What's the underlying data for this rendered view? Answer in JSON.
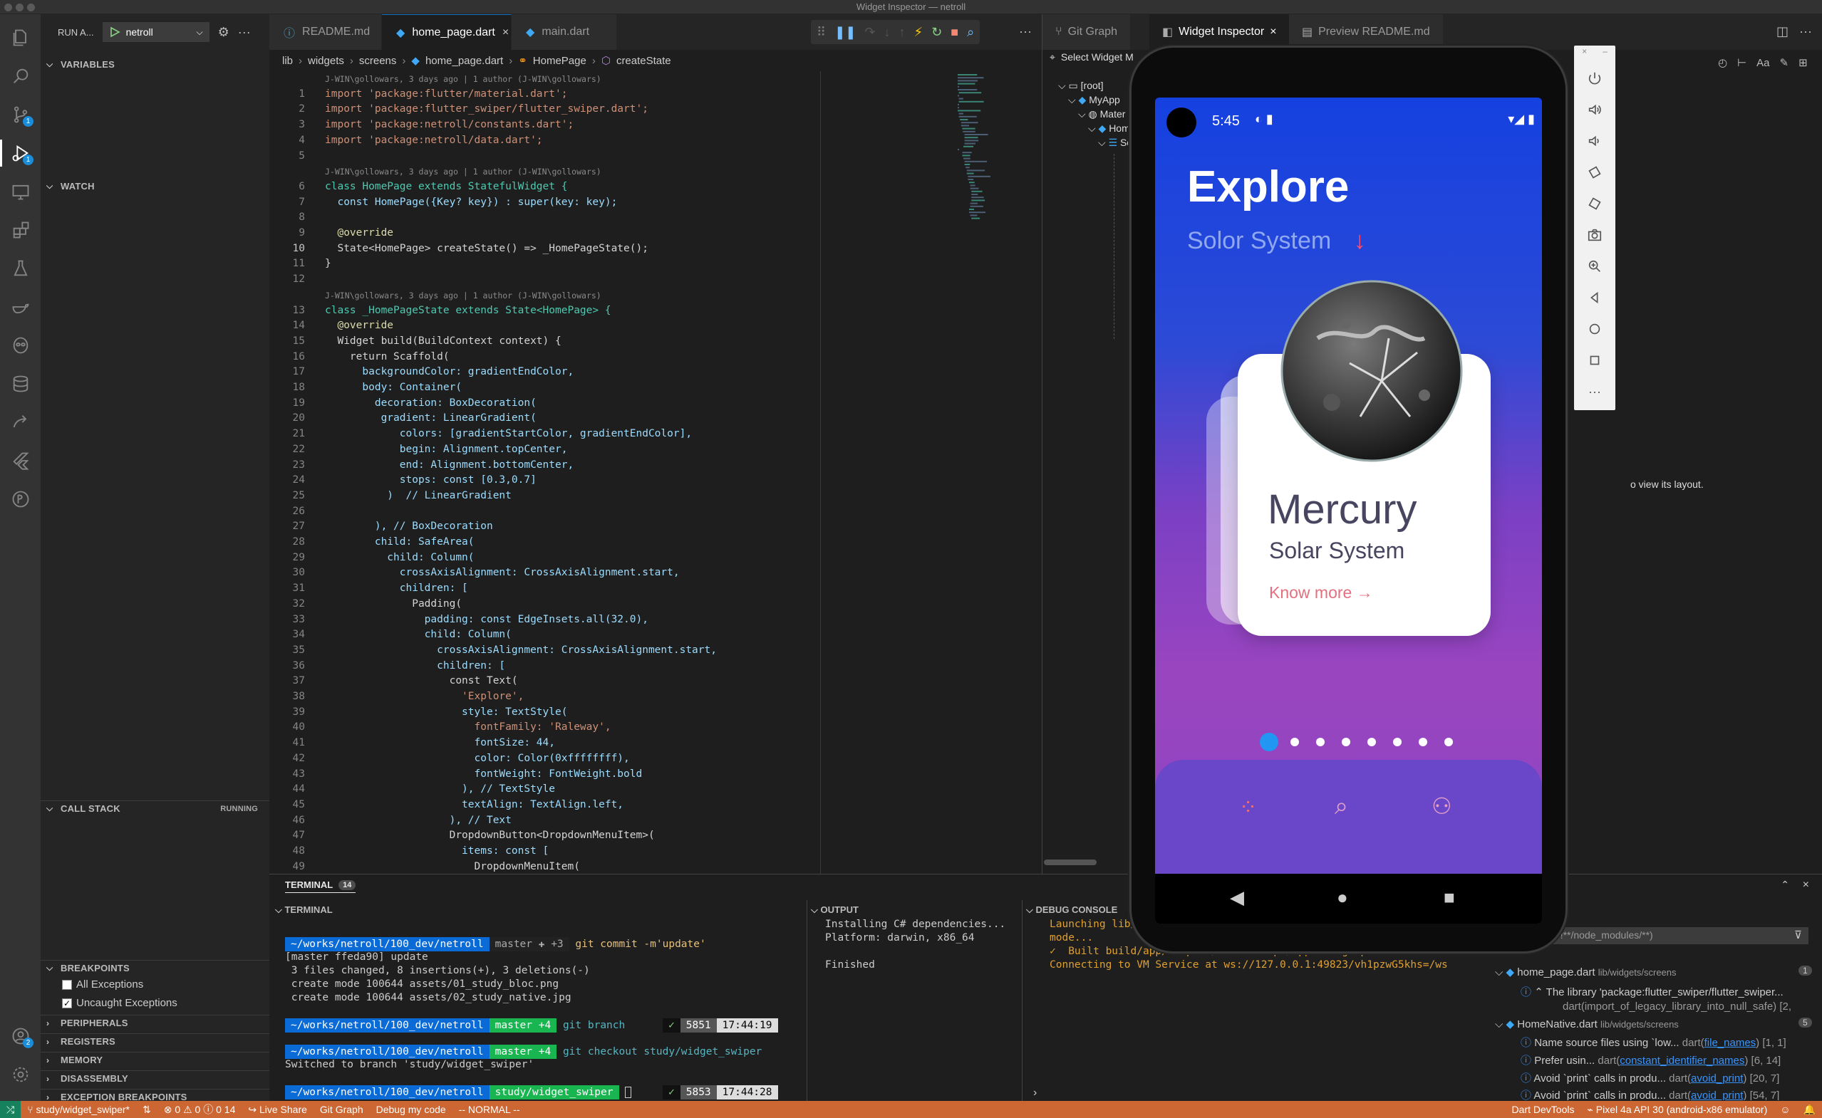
{
  "window_title": "Widget Inspector — netroll",
  "activity_bar": [
    {
      "icon": "files-icon"
    },
    {
      "icon": "search-icon"
    },
    {
      "icon": "source-control-icon",
      "badge": "1"
    },
    {
      "icon": "run-debug-icon",
      "badge": "1"
    },
    {
      "icon": "remote-explorer-icon"
    },
    {
      "icon": "extensions-icon"
    },
    {
      "icon": "testing-icon"
    },
    {
      "icon": "docker-icon"
    },
    {
      "icon": "alien-icon"
    },
    {
      "icon": "database-icon"
    },
    {
      "icon": "live-share-icon"
    },
    {
      "icon": "flutter-icon"
    },
    {
      "icon": "timeline-icon"
    }
  ],
  "accounts_badge": "2",
  "sidebar": {
    "run_label": "RUN A...",
    "config": "netroll",
    "variables": "VARIABLES",
    "watch": "WATCH",
    "call_stack": "CALL STACK",
    "call_stack_state": "RUNNING",
    "breakpoints": "BREAKPOINTS",
    "bp_all": "All Exceptions",
    "bp_uncaught": "Uncaught Exceptions",
    "peripherals": "PERIPHERALS",
    "registers": "REGISTERS",
    "memory": "MEMORY",
    "disassembly": "DISASSEMBLY",
    "exception_breakpoints": "EXCEPTION BREAKPOINTS"
  },
  "editor": {
    "tabs": [
      "README.md",
      "home_page.dart",
      "main.dart"
    ],
    "breadcrumb": [
      "lib",
      "widgets",
      "screens",
      "home_page.dart",
      "HomePage",
      "createState"
    ],
    "blame": [
      "J-WIN\\gollowars, 3 days ago | 1 author (J-WIN\\gollowars)",
      "J-WIN\\gollowars, 3 days ago | 1 author (J-WIN\\gollowars)",
      "J-WIN\\gollowars, 3 days ago | 1 author (J-WIN\\gollowars)"
    ],
    "lines": [
      "import 'package:flutter/material.dart';",
      "import 'package:flutter_swiper/flutter_swiper.dart';",
      "import 'package:netroll/constants.dart';",
      "import 'package:netroll/data.dart';",
      "",
      "class HomePage extends StatefulWidget {",
      "  const HomePage({Key? key}) : super(key: key);",
      "",
      "  @override",
      "  State<HomePage> createState() => _HomePageState();",
      "}",
      "",
      "class _HomePageState extends State<HomePage> {",
      "  @override",
      "  Widget build(BuildContext context) {",
      "    return Scaffold(",
      "      backgroundColor: gradientEndColor,",
      "      body: Container(",
      "        decoration: BoxDecoration(",
      "         gradient: LinearGradient(",
      "            colors: [gradientStartColor, gradientEndColor],",
      "            begin: Alignment.topCenter,",
      "            end: Alignment.bottomCenter,",
      "            stops: const [0.3,0.7]",
      "          )  // LinearGradient",
      "",
      "        ), // BoxDecoration",
      "        child: SafeArea(",
      "          child: Column(",
      "            crossAxisAlignment: CrossAxisAlignment.start,",
      "            children: [",
      "              Padding(",
      "                padding: const EdgeInsets.all(32.0),",
      "                child: Column(",
      "                  crossAxisAlignment: CrossAxisAlignment.start,",
      "                  children: [",
      "                    const Text(",
      "                      'Explore',",
      "                      style: TextStyle(",
      "                        fontFamily: 'Raleway',",
      "                        fontSize: 44,",
      "                        color: Color(0xffffffff),",
      "                        fontWeight: FontWeight.bold",
      "                      ), // TextStyle",
      "                      textAlign: TextAlign.left,",
      "                    ), // Text",
      "                    DropdownButton<DropdownMenuItem>(",
      "                      items: const [",
      "                        DropdownMenuItem("
    ]
  },
  "right_group": {
    "tabs": [
      "Git Graph",
      "Widget Inspector",
      "Preview README.md"
    ],
    "select_widget": "Select Widget M",
    "tree": [
      "[root]",
      "MyApp",
      "Mater",
      "Hom",
      "Sc"
    ],
    "layout_hint": "o view its layout."
  },
  "phone": {
    "time": "5:45",
    "title": "Explore",
    "subtitle": "Solor System",
    "planet_name": "Mercury",
    "planet_system": "Solar System",
    "know_more": "Know more",
    "dots_total": 8,
    "dots_active": 1
  },
  "panel": {
    "terminal_tab": "TERMINAL",
    "terminal_count": "14",
    "terminal_title": "TERMINAL",
    "output_title": "OUTPUT",
    "debug_title": "DEBUG CONSOLE",
    "terminal": {
      "prompt_path": "~/works/netroll/100_dev/netroll",
      "c1_branch": "master ✚ +3",
      "c1_cmd": "git commit -m'update'",
      "l1": "[master ffeda90] update",
      "l2": " 3 files changed, 8 insertions(+), 3 deletions(-)",
      "l3": " create mode 100644 assets/01_study_bloc.png",
      "l4": " create mode 100644 assets/02_study_native.jpg",
      "c2_branch": "master +4",
      "c2_cmd": "git branch",
      "c2_num": "5851",
      "c2_time": "17:44:19",
      "c3_branch": "master +4",
      "c3_cmd": "git checkout study/widget_swiper",
      "l5": "Switched to branch 'study/widget_swiper'",
      "c4_branch": "study/widget_swiper",
      "c4_num": "5853",
      "c4_time": "17:44:28"
    },
    "output": [
      "Installing C# dependencies...",
      "Platform: darwin, x86_64",
      "",
      "Finished"
    ],
    "debug": [
      "Launching lib/",
      "mode...",
      "✓  Built build/app/outputs/flutter-apk/app-debug.apk.",
      "Connecting to VM Service at ws://127.0.0.1:49823/vh1pzwG5khs=/ws"
    ],
    "filter_placeholder": "g. text, **/*.ts, !**/node_modules/**)",
    "problems": [
      {
        "file": "home_page.dart",
        "path": "lib/widgets/screens",
        "count": "1"
      },
      {
        "msg": "The library 'package:flutter_swiper/flutter_swiper...",
        "sub": "dart(import_of_legacy_library_into_null_safe) [2,"
      },
      {
        "file": "HomeNative.dart",
        "path": "lib/widgets/screens",
        "count": "5"
      },
      {
        "msg": "Name source files using `low...",
        "src": "dart(",
        "link": "file_names",
        "pos": ") [1, 1]"
      },
      {
        "msg": "Prefer usin...",
        "src": "dart(",
        "link": "constant_identifier_names",
        "pos": ") [6, 14]"
      },
      {
        "msg": "Avoid `print` calls in produ...",
        "src": "dart(",
        "link": "avoid_print",
        "pos": ") [20, 7]"
      },
      {
        "msg": "Avoid `print` calls in produ...",
        "src": "dart(",
        "link": "avoid_print",
        "pos": ") [54, 7]"
      }
    ]
  },
  "statusbar": {
    "branch": "study/widget_swiper*",
    "errors": "0",
    "warnings": "0",
    "info": "0",
    "infos2": "14",
    "live_share": "Live Share",
    "git_graph": "Git Graph",
    "debug_my_code": "Debug my code",
    "vim_mode": "-- NORMAL --",
    "devtools": "Dart DevTools",
    "device": "Pixel 4a API 30 (android-x86 emulator)"
  },
  "colors": {
    "accent": "#0e70c0",
    "statusbar": "#cc6633",
    "phone_accent": "#ff4d6d"
  }
}
